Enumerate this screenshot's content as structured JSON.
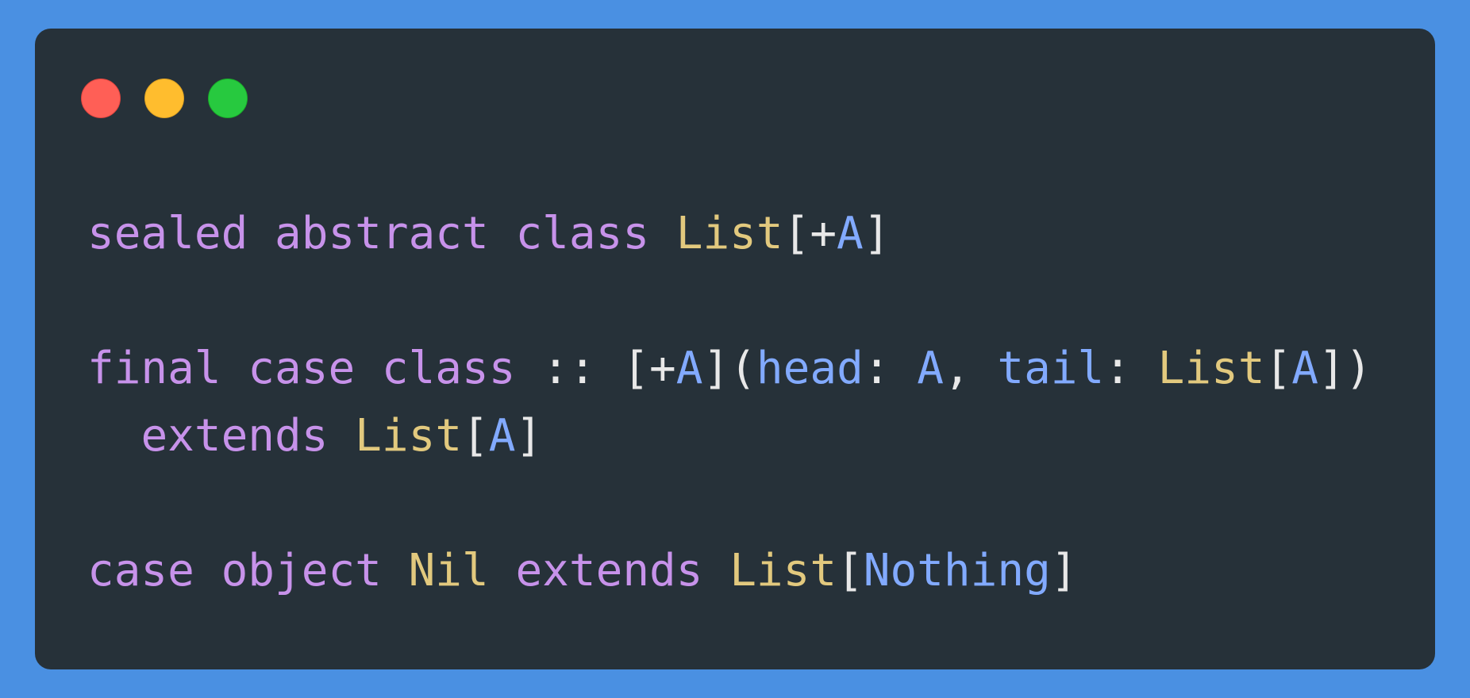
{
  "window": {
    "controls": [
      {
        "name": "close",
        "color": "#ff5f56"
      },
      {
        "name": "minimize",
        "color": "#ffbd2e"
      },
      {
        "name": "maximize",
        "color": "#27c93f"
      }
    ]
  },
  "code": {
    "language": "scala",
    "lines": [
      "sealed abstract class List[+A]",
      "",
      "final case class :: [+A](head: A, tail: List[A])",
      "  extends List[A]",
      "",
      "case object Nil extends List[Nothing]"
    ],
    "tokens": {
      "l1_sealed": "sealed",
      "l1_abstract": "abstract",
      "l1_class": "class",
      "l1_list": "List",
      "l1_open": "[+",
      "l1_a": "A",
      "l1_close": "]",
      "l3_final": "final",
      "l3_case": "case",
      "l3_class": "class",
      "l3_cons": "::",
      "l3_open": "[+",
      "l3_a": "A",
      "l3_close_paren_open": "](",
      "l3_head": "head",
      "l3_colon1": ":",
      "l3_a2": "A",
      "l3_comma": ",",
      "l3_tail": "tail",
      "l3_colon2": ":",
      "l3_list": "List",
      "l3_br_open": "[",
      "l3_a3": "A",
      "l3_end": "])",
      "l4_extends": "extends",
      "l4_list": "List",
      "l4_br_open": "[",
      "l4_a": "A",
      "l4_br_close": "]",
      "l6_case": "case",
      "l6_object": "object",
      "l6_nil": "Nil",
      "l6_extends": "extends",
      "l6_list": "List",
      "l6_br_open": "[",
      "l6_nothing": "Nothing",
      "l6_br_close": "]"
    },
    "colors": {
      "keyword": "#c792ea",
      "type": "#e2c97e",
      "type_param": "#82aaff",
      "punctuation": "#e8e8e8",
      "background": "#263139",
      "page": "#4a90e2"
    }
  }
}
